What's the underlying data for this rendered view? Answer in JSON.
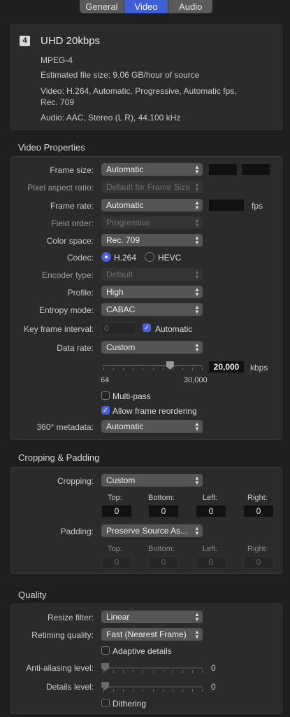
{
  "tabs": [
    "General",
    "Video",
    "Audio"
  ],
  "summary": {
    "badge": "4",
    "title": "UHD 20kbps",
    "format": "MPEG-4",
    "file_size": "Estimated file size: 9.06 GB/hour of source",
    "video_line1": "Video: H.264, Automatic, Progressive, Automatic fps,",
    "video_line2": "Rec. 709",
    "audio": "Audio: AAC, Stereo (L R), 44.100 kHz"
  },
  "video_properties": {
    "title": "Video Properties",
    "frame_size_label": "Frame size:",
    "frame_size_value": "Automatic",
    "pixel_aspect_label": "Pixel aspect ratio:",
    "pixel_aspect_value": "Default for Frame Size",
    "frame_rate_label": "Frame rate:",
    "frame_rate_value": "Automatic",
    "fps": "fps",
    "field_order_label": "Field order:",
    "field_order_value": "Progressive",
    "color_space_label": "Color space:",
    "color_space_value": "Rec. 709",
    "codec_label": "Codec:",
    "codec_h264": "H.264",
    "codec_hevc": "HEVC",
    "encoder_type_label": "Encoder type:",
    "encoder_type_value": "Default",
    "profile_label": "Profile:",
    "profile_value": "High",
    "entropy_label": "Entropy mode:",
    "entropy_value": "CABAC",
    "keyframe_label": "Key frame interval:",
    "keyframe_value": "0",
    "automatic_label": "Automatic",
    "data_rate_label": "Data rate:",
    "data_rate_value": "Custom",
    "data_rate_field": "20,000",
    "kbps": "kbps",
    "slider_min": "64",
    "slider_max": "30,000",
    "slider_level": 0.67,
    "multipass_label": "Multi-pass",
    "reorder_label": "Allow frame reordering",
    "metadata_label": "360° metadata:",
    "metadata_value": "Automatic"
  },
  "cropping": {
    "title": "Cropping & Padding",
    "cropping_label": "Cropping:",
    "cropping_value": "Custom",
    "top": "Top:",
    "bottom": "Bottom:",
    "left": "Left:",
    "right": "Right:",
    "crop_top": "0",
    "crop_bottom": "0",
    "crop_left": "0",
    "crop_right": "0",
    "padding_label": "Padding:",
    "padding_value": "Preserve Source As...",
    "pad_top": "0",
    "pad_bottom": "0",
    "pad_left": "0",
    "pad_right": "0"
  },
  "quality": {
    "title": "Quality",
    "resize_label": "Resize filter:",
    "resize_value": "Linear",
    "retiming_label": "Retiming quality:",
    "retiming_value": "Fast (Nearest Frame)",
    "adaptive_label": "Adaptive details",
    "antialias_label": "Anti-aliasing level:",
    "antialias_value": "0",
    "details_label": "Details level:",
    "details_value": "0",
    "dithering_label": "Dithering"
  },
  "colors": {
    "accent": "#4a5fd8",
    "background": "#1f1f1f",
    "panel": "#2b2b2b"
  }
}
